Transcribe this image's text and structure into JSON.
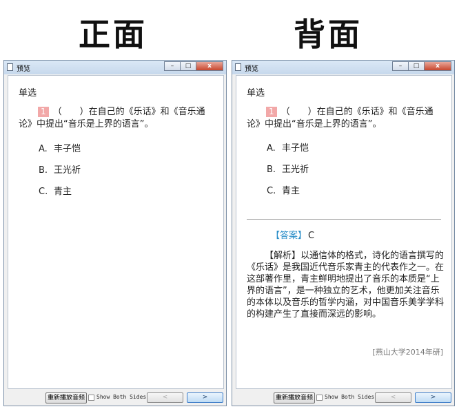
{
  "headings": {
    "front": "正面",
    "back": "背面"
  },
  "window": {
    "title": "预览",
    "controls": {
      "minimize": "–",
      "maximize": "□",
      "close": "x"
    }
  },
  "question": {
    "type": "单选",
    "number": "1",
    "text": "（　　）在自己的《乐话》和《音乐通论》中提出“音乐是上界的语言”。",
    "options": [
      {
        "key": "A.",
        "text": "丰子恺"
      },
      {
        "key": "B.",
        "text": "王光祈"
      },
      {
        "key": "C.",
        "text": "青主"
      }
    ]
  },
  "answer": {
    "tag": "【答案】",
    "value": "C",
    "analysis": "【解析】以通信体的格式，诗化的语言撰写的《乐话》是我国近代音乐家青主的代表作之一。在这部著作里，青主鲜明地提出了音乐的本质是“上界的语言”，是一种独立的艺术，他更加关注音乐的本体以及音乐的哲学内涵，对中国音乐美学学科的构建产生了直接而深远的影响。",
    "source": "[燕山大学2014年研]"
  },
  "footer": {
    "replay_label": "重新播放音频",
    "show_both_label": "Show Both Sides",
    "show_both_checked": false,
    "prev_label": "<",
    "next_label": ">"
  }
}
